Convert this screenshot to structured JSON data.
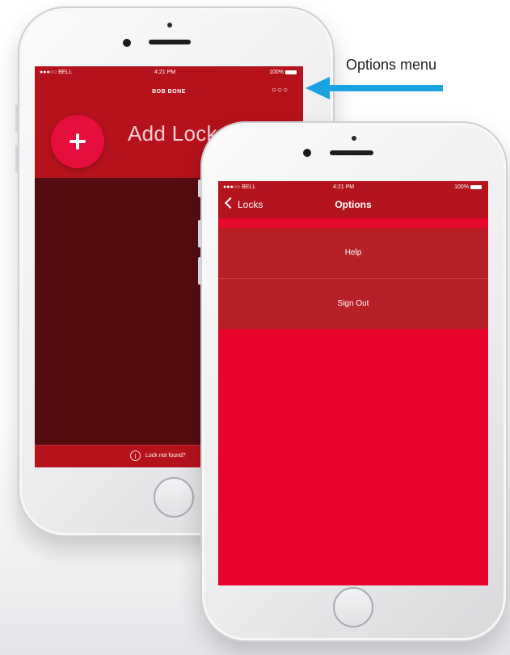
{
  "annotation": {
    "label": "Options menu",
    "arrow_color": "#1aa3e0"
  },
  "back_phone": {
    "status_bar": {
      "carrier": "●●●○○ BELL",
      "time": "4:21 PM",
      "battery": "100%"
    },
    "logo_text": "BOB BONE",
    "more_icon": "ellipsis-icon",
    "add_lock_label": "Add Lock",
    "footer_text": "Lock not found?",
    "colors": {
      "header": "#b5121b",
      "list": "#560d12",
      "button": "#e60e3c"
    }
  },
  "front_phone": {
    "status_bar": {
      "carrier": "●●●○○ BELL",
      "time": "4:21 PM",
      "battery": "100%"
    },
    "nav": {
      "back_label": "Locks",
      "title": "Options"
    },
    "menu_items": [
      {
        "label": "Help"
      },
      {
        "label": "Sign Out"
      }
    ],
    "colors": {
      "nav": "#b3141d",
      "row": "#b82028",
      "body": "#e8042c"
    }
  }
}
